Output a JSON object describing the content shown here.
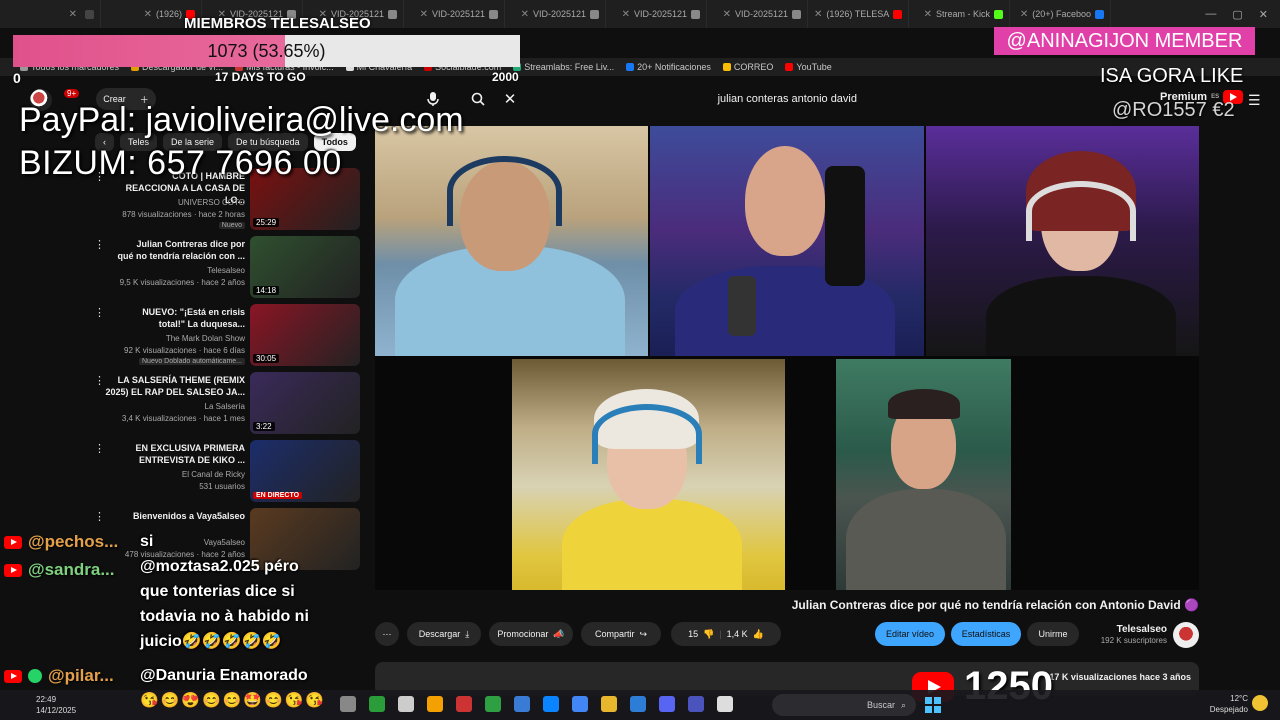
{
  "browser": {
    "tabs": [
      {
        "label": "(20+) Faceboo",
        "color": "#1877f2"
      },
      {
        "label": "Stream - Kick",
        "color": "#53fc18"
      },
      {
        "label": "(1926) TELESA",
        "color": "#ff0000"
      },
      {
        "label": "VID-2025121",
        "color": "#888888"
      },
      {
        "label": "VID-2025121",
        "color": "#888888"
      },
      {
        "label": "VID-2025121",
        "color": "#888888"
      },
      {
        "label": "VID-2025121",
        "color": "#888888"
      },
      {
        "label": "VID-2025121",
        "color": "#888888"
      },
      {
        "label": "VID-2025121",
        "color": "#888888"
      },
      {
        "label": "(1926)",
        "color": "#ff0000"
      },
      {
        "label": "",
        "color": "#444444"
      }
    ],
    "bookmarks": [
      "Todos los marcadores",
      "Descargador de ví...",
      "Mis facturas - Invoic...",
      "Mi Chavalería",
      "Socialblade.com",
      "Streamlabs: Free Liv...",
      "20+ Notificaciones",
      "CORREO",
      "YouTube"
    ]
  },
  "youtube": {
    "notif_count": "9+",
    "crear_label": "Crear",
    "search_query": "julian conteras antonio david",
    "premium_label": "Premium",
    "premium_region": "ES",
    "chips": [
      "Todos",
      "De tu búsqueda",
      "De la serie",
      "Teles"
    ],
    "recommended": [
      {
        "title": "COTO | HAMBRE\nREACCIONA A LA CASA DE LO...",
        "channel": "UNIVERSO COTO",
        "meta": "878 visualizaciones · hace 2 horas",
        "badge": "Nuevo",
        "duration": "25:29",
        "thumb": "#7a1010"
      },
      {
        "title": "Julian Contreras dice por\nqué no tendría relación con ...",
        "channel": "Telesalseo",
        "meta": "9,5 K visualizaciones · hace 2 años",
        "badge": "",
        "duration": "14:18",
        "thumb": "#2f4f2f"
      },
      {
        "title": "NUEVO: \"¡Está en crisis\ntotal!\" La duquesa...",
        "channel": "The Mark Dolan Show",
        "meta": "92 K visualizaciones · hace 6 días",
        "badge": "Nuevo  Doblado automáticame...",
        "duration": "30:05",
        "thumb": "#8a1525"
      },
      {
        "title": "LA SALSERÍA THEME (REMIX\n2025) EL RAP DEL SALSEO JA...",
        "channel": "La Salsería",
        "meta": "3,4 K visualizaciones · hace 1 mes",
        "badge": "",
        "duration": "3:22",
        "thumb": "#3a2a5a"
      },
      {
        "title": "EN EXCLUSIVA PRIMERA\nENTREVISTA DE KIKO ...",
        "channel": "El Canal de Ricky",
        "meta": "531 usuarios",
        "badge": "",
        "duration": "EN DIRECTO",
        "thumb": "#1c2d6b"
      },
      {
        "title": "Bienvenidos a Vaya5alseo",
        "channel": "Vaya5alseo",
        "meta": "478 visualizaciones · hace 2 años",
        "badge": "",
        "duration": "",
        "thumb": "#5a3a20"
      }
    ],
    "video_title": "Julian Contreras dice por qué no tendría relación con Antonio David",
    "channel_name": "Telesalseo",
    "channel_subs": "192 K suscriptores",
    "actions": {
      "join": "Unirme",
      "stats": "Estadísticas",
      "edit": "Editar vídeo",
      "likes": "1,4 K",
      "dislikes": "15",
      "share": "Compartir",
      "promote": "Promocionar",
      "download": "Descargar",
      "more": "⋯"
    },
    "desc_meta": "17 K visualizaciones  hace 3 años"
  },
  "overlay": {
    "goal_title": "MIEMBROS TELESALSEO",
    "goal_value_text": "1073 (53.65%)",
    "goal_fraction": 0.5365,
    "goal_min": "0",
    "goal_max": "2000",
    "goal_days": "17 DAYS TO GO",
    "paypal": "PayPal: javioliveira@live.com",
    "bizum": "BIZUM: 657 7696 00",
    "member_badge": "@ANINAGIJON  MEMBER",
    "gora": "ISA GORA  LIKE",
    "donor": "@RO1557  €2",
    "like_count": "1250",
    "chat": [
      {
        "user": "@pechos...",
        "msg_lines": [
          "si",
          "@moztasa2.025 péro",
          "que tonterias dice si",
          "todavia no à habido ni",
          "juicio🤣🤣🤣🤣🤣"
        ]
      },
      {
        "user": "@sandra...",
        "msg_lines": []
      },
      {
        "user": "@pilar...",
        "msg_lines": [
          "@Danuria Enamorado"
        ]
      }
    ],
    "emojis": "😘😊😍😊😊🤩😊😘😘"
  },
  "taskbar": {
    "time": "22:49",
    "date": "14/12/2025",
    "search": "Buscar",
    "temp": "12°C",
    "weather": "Despejado"
  }
}
